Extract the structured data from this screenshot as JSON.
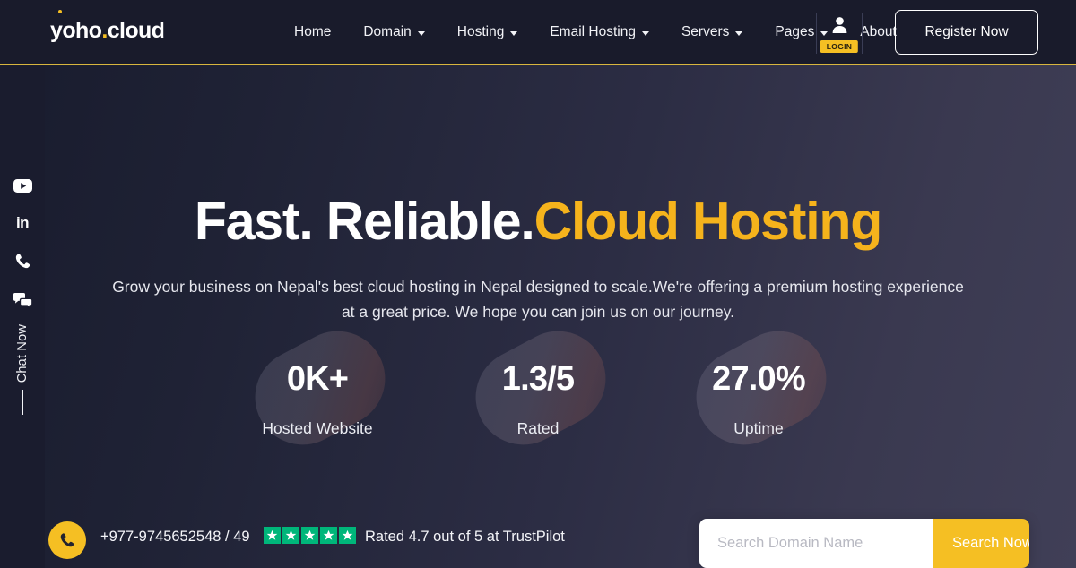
{
  "brand": {
    "name_prefix": "y",
    "name_mid": "oho",
    "name_dot": ".",
    "name_suffix": "cloud",
    "accent_color": "#f5bf23"
  },
  "header": {
    "nav": [
      {
        "label": "Home",
        "has_dropdown": false
      },
      {
        "label": "Domain",
        "has_dropdown": true
      },
      {
        "label": "Hosting",
        "has_dropdown": true
      },
      {
        "label": "Email Hosting",
        "has_dropdown": true
      },
      {
        "label": "Servers",
        "has_dropdown": true
      },
      {
        "label": "Pages",
        "has_dropdown": true
      },
      {
        "label": "About",
        "has_dropdown": false
      }
    ],
    "login_badge": "LOGIN",
    "register_label": "Register Now",
    "border_color": "#d8b63e",
    "background": "#191b2b"
  },
  "hero": {
    "headline_white": "Fast. Reliable.",
    "headline_accent": "Cloud Hosting",
    "subtitle": "Grow your business on Nepal's best cloud hosting in Nepal designed to scale.We're offering a premium hosting experience at a great price. We hope you can join us on our journey.",
    "stats": [
      {
        "value": "0K+",
        "label": "Hosted Website"
      },
      {
        "value": "1.3/5",
        "label": "Rated"
      },
      {
        "value": "27.0%",
        "label": "Uptime"
      }
    ]
  },
  "rail": {
    "items": [
      {
        "icon": "youtube-icon"
      },
      {
        "icon": "linkedin-icon",
        "text": "in"
      },
      {
        "icon": "phone-icon"
      },
      {
        "icon": "chat-bubbles-icon"
      }
    ],
    "chat_now_label": "Chat Now"
  },
  "bottom": {
    "phone_number": "+977-9745652548 / 49",
    "trust_text": "Rated 4.7 out of 5 at TrustPilot",
    "star_count": 5,
    "star_color": "#00b67a",
    "search_placeholder": "Search Domain Name",
    "search_value": "",
    "search_button_label": "Search Now"
  }
}
